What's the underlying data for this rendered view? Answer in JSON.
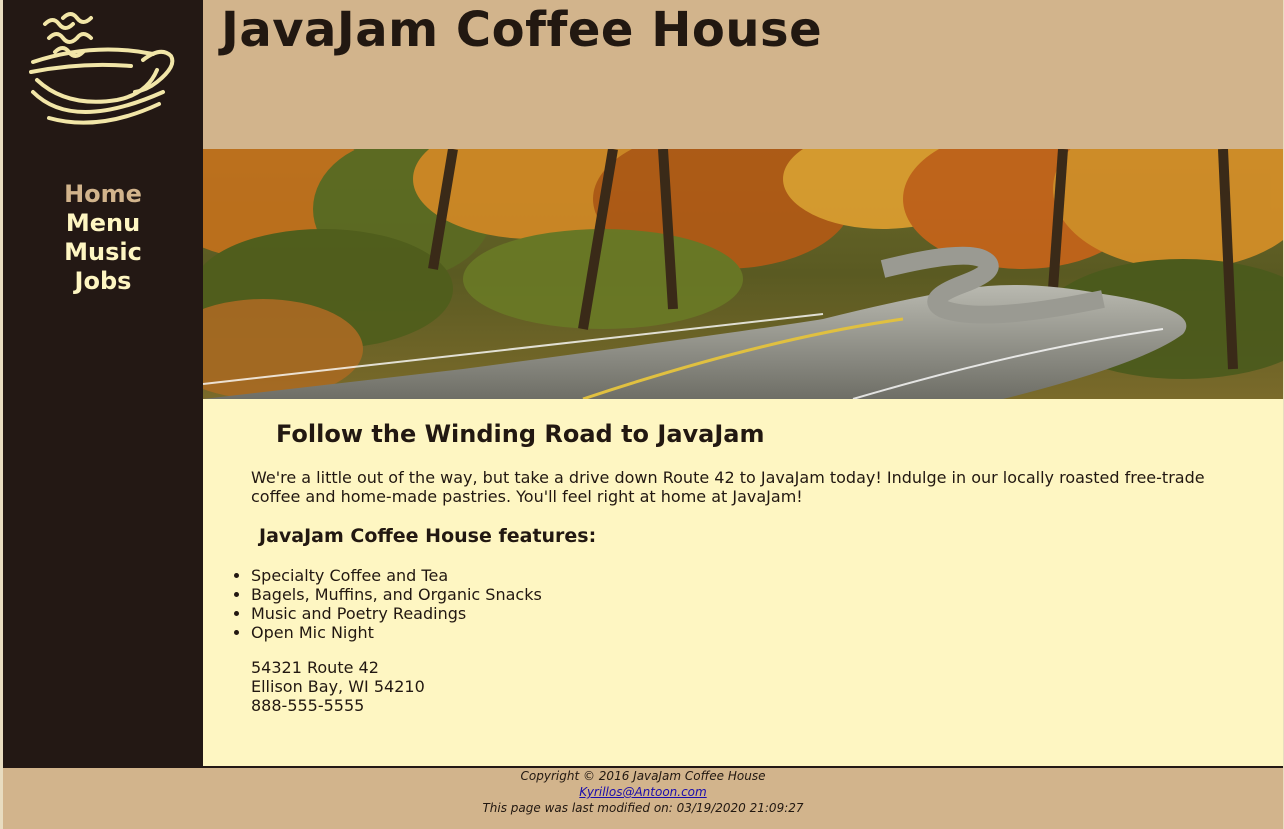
{
  "header": {
    "title": "JavaJam Coffee House"
  },
  "nav": {
    "items": [
      {
        "label": "Home",
        "current": true
      },
      {
        "label": "Menu",
        "current": false
      },
      {
        "label": "Music",
        "current": false
      },
      {
        "label": "Jobs",
        "current": false
      }
    ]
  },
  "main": {
    "heading": "Follow the Winding Road to JavaJam",
    "intro": "We're a little out of the way, but take a drive down Route 42 to JavaJam today! Indulge in our locally roasted free-trade coffee and home-made pastries. You'll feel right at home at JavaJam!",
    "features_heading": "JavaJam Coffee House features:",
    "features": [
      "Specialty Coffee and Tea",
      "Bagels, Muffins, and Organic Snacks",
      "Music and Poetry Readings",
      "Open Mic Night"
    ],
    "address": {
      "street": "54321 Route 42",
      "city": "Ellison Bay, WI 54210",
      "phone": "888-555-5555"
    }
  },
  "footer": {
    "copyright": "Copyright © 2016 JavaJam Coffee House",
    "email": "Kyrillos@Antoon.com",
    "modified": "This page was last modified on: 03/19/2020 21:09:27"
  },
  "colors": {
    "dark_brown": "#231814",
    "tan": "#d2b48c",
    "cream": "#fef6c2",
    "text": "#221811"
  },
  "icons": {
    "logo": "steaming-coffee-cup-icon"
  },
  "images": {
    "hero": "winding-road-autumn-forest-photo"
  }
}
